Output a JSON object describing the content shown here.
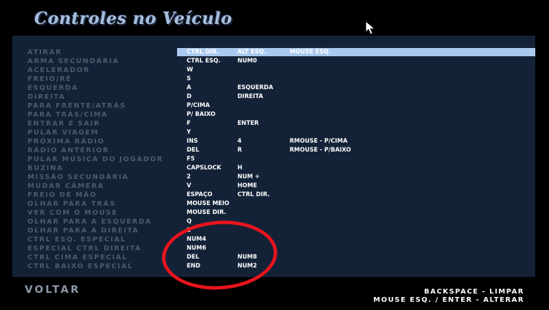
{
  "title": "Controles no Veículo",
  "rows": [
    {
      "label": "ATIRAR",
      "c1": "CTRL DIR.",
      "c2": "ALT ESQ.",
      "c3": "MOUSE ESQ.",
      "selected": true
    },
    {
      "label": "ARMA SECUNDÁRIA",
      "c1": "CTRL ESQ.",
      "c2": "NUM0",
      "c3": ""
    },
    {
      "label": "ACELERADOR",
      "c1": "W",
      "c2": "",
      "c3": ""
    },
    {
      "label": "FREIO/RÉ",
      "c1": "S",
      "c2": "",
      "c3": ""
    },
    {
      "label": "ESQUERDA",
      "c1": "A",
      "c2": "ESQUERDA",
      "c3": ""
    },
    {
      "label": "DIREITA",
      "c1": "D",
      "c2": "DIREITA",
      "c3": ""
    },
    {
      "label": "PARA FRENTE/ATRÁS",
      "c1": "P/CIMA",
      "c2": "",
      "c3": ""
    },
    {
      "label": "PARA TRÁS/CIMA",
      "c1": "P/ BAIXO",
      "c2": "",
      "c3": ""
    },
    {
      "label": "ENTRAR E SAIR",
      "c1": "F",
      "c2": "ENTER",
      "c3": ""
    },
    {
      "label": "PULAR VIAGEM",
      "c1": "Y",
      "c2": "",
      "c3": ""
    },
    {
      "label": "PRÓXIMA RÁDIO",
      "c1": "INS",
      "c2": "4",
      "c3": "RMOUSE - P/CIMA"
    },
    {
      "label": "RÁDIO ANTERIOR",
      "c1": "DEL",
      "c2": "R",
      "c3": "RMOUSE - P/BAIXO"
    },
    {
      "label": "PULAR MÚSICA DO JOGADOR",
      "c1": "F5",
      "c2": "",
      "c3": ""
    },
    {
      "label": "BUZINA",
      "c1": "CAPSLOCK",
      "c2": "H",
      "c3": ""
    },
    {
      "label": "MISSÃO SECUNDÁRIA",
      "c1": "2",
      "c2": "NUM +",
      "c3": ""
    },
    {
      "label": "MUDAR CÂMERA",
      "c1": "V",
      "c2": "HOME",
      "c3": ""
    },
    {
      "label": "FREIO DE MÃO",
      "c1": "ESPAÇO",
      "c2": "CTRL DIR.",
      "c3": ""
    },
    {
      "label": "OLHAR PARA TRÁS",
      "c1": "MOUSE MEIO",
      "c2": "",
      "c3": ""
    },
    {
      "label": "VER COM O MOUSE",
      "c1": "MOUSE DIR.",
      "c2": "",
      "c3": ""
    },
    {
      "label": "OLHAR PARA A ESQUERDA",
      "c1": "Q",
      "c2": "",
      "c3": ""
    },
    {
      "label": "OLHAR PARA A DIREITA",
      "c1": "E",
      "c2": "",
      "c3": ""
    },
    {
      "label": "CTRL ESQ. ESPECIAL",
      "c1": "NUM4",
      "c2": "",
      "c3": ""
    },
    {
      "label": "ESPECIAL CTRL DIREITA",
      "c1": "NUM6",
      "c2": "",
      "c3": ""
    },
    {
      "label": "CTRL CIMA ESPECIAL",
      "c1": "DEL",
      "c2": "NUM8",
      "c3": ""
    },
    {
      "label": "CTRL BAIXO ESPECIAL",
      "c1": "END",
      "c2": "NUM2",
      "c3": ""
    }
  ],
  "footer": {
    "back_label": "VOLTAR",
    "hint_clear": "BACKSPACE - LIMPAR",
    "hint_change": "MOUSE ESQ. / ENTER - ALTERAR"
  },
  "colors": {
    "panel": "#142238",
    "selection": "#a9c9ee",
    "annotation_circle": "#e8141e"
  }
}
